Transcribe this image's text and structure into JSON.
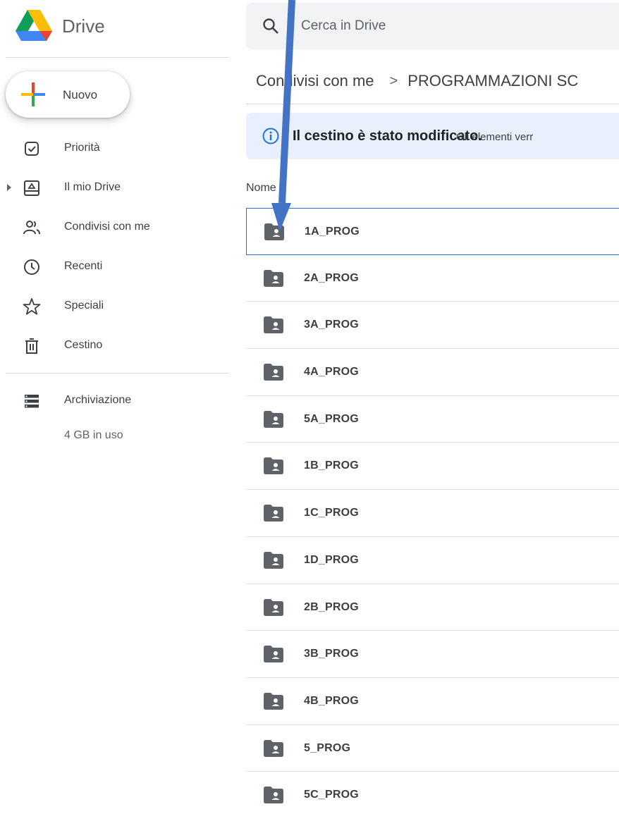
{
  "app": {
    "title": "Drive"
  },
  "sidebar": {
    "new_label": "Nuovo",
    "items": [
      {
        "label": "Priorità",
        "icon": "priority-icon"
      },
      {
        "label": "Il mio Drive",
        "icon": "my-drive-icon"
      },
      {
        "label": "Condivisi con me",
        "icon": "shared-icon"
      },
      {
        "label": "Recenti",
        "icon": "clock-icon"
      },
      {
        "label": "Speciali",
        "icon": "star-icon"
      },
      {
        "label": "Cestino",
        "icon": "trash-icon"
      }
    ],
    "storage": {
      "label": "Archiviazione",
      "usage": "4 GB in uso"
    }
  },
  "search": {
    "placeholder": "Cerca in Drive"
  },
  "breadcrumb": {
    "parent": "Condivisi con me",
    "separator": ">",
    "current": "PROGRAMMAZIONI SC"
  },
  "banner": {
    "title": "Il cestino è stato modificato.",
    "detail": "Gli elementi verr"
  },
  "list": {
    "column_header": "Nome",
    "files": [
      {
        "name": "1A_PROG",
        "selected": true
      },
      {
        "name": "2A_PROG"
      },
      {
        "name": "3A_PROG"
      },
      {
        "name": "4A_PROG"
      },
      {
        "name": "5A_PROG"
      },
      {
        "name": "1B_PROG"
      },
      {
        "name": "1C_PROG"
      },
      {
        "name": "1D_PROG"
      },
      {
        "name": "2B_PROG"
      },
      {
        "name": "3B_PROG"
      },
      {
        "name": "4B_PROG"
      },
      {
        "name": "5_PROG"
      },
      {
        "name": "5C_PROG"
      }
    ]
  },
  "colors": {
    "accent": "#1a73e8",
    "banner_bg": "#e8f0fe",
    "search_bg": "#f1f3f4",
    "annotation_arrow": "#4472c4",
    "folder": "#5f6368"
  }
}
